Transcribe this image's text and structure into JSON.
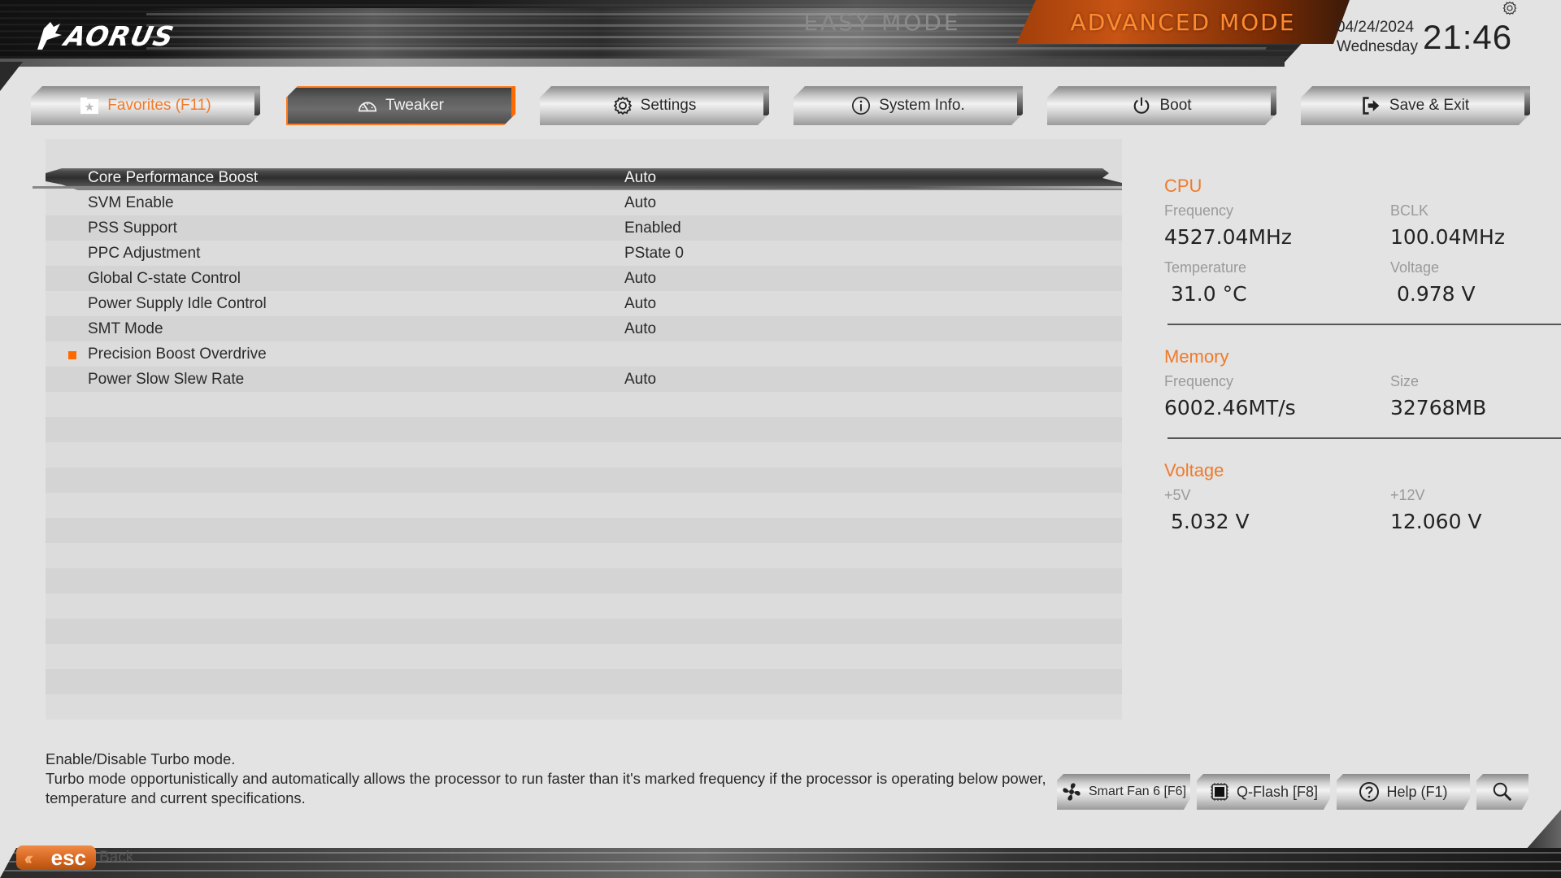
{
  "header": {
    "brand": "AORUS",
    "modes": {
      "easy": "EASY MODE",
      "advanced": "ADVANCED MODE",
      "active": "advanced"
    },
    "date": "04/24/2024",
    "weekday": "Wednesday",
    "time": "21:46"
  },
  "tabs": [
    {
      "label": "Favorites (F11)",
      "icon": "star-folder-icon",
      "active": false,
      "accent": true
    },
    {
      "label": "Tweaker",
      "icon": "speedometer-icon",
      "active": true
    },
    {
      "label": "Settings",
      "icon": "gear-icon",
      "active": false
    },
    {
      "label": "System Info.",
      "icon": "info-circle-icon",
      "active": false
    },
    {
      "label": "Boot",
      "icon": "power-icon",
      "active": false
    },
    {
      "label": "Save & Exit",
      "icon": "exit-icon",
      "active": false
    }
  ],
  "settings": [
    {
      "label": "Core Performance Boost",
      "value": "Auto",
      "selected": true,
      "submenu": false
    },
    {
      "label": "SVM Enable",
      "value": "Auto",
      "selected": false,
      "submenu": false
    },
    {
      "label": "PSS Support",
      "value": "Enabled",
      "selected": false,
      "submenu": false
    },
    {
      "label": "PPC Adjustment",
      "value": "PState 0",
      "selected": false,
      "submenu": false
    },
    {
      "label": "Global C-state Control",
      "value": "Auto",
      "selected": false,
      "submenu": false
    },
    {
      "label": "Power Supply Idle Control",
      "value": "Auto",
      "selected": false,
      "submenu": false
    },
    {
      "label": "SMT Mode",
      "value": "Auto",
      "selected": false,
      "submenu": false
    },
    {
      "label": "Precision Boost Overdrive",
      "value": "",
      "selected": false,
      "submenu": true
    },
    {
      "label": "Power Slow Slew Rate",
      "value": "Auto",
      "selected": false,
      "submenu": false
    }
  ],
  "info": {
    "cpu": {
      "title": "CPU",
      "frequency_label": "Frequency",
      "frequency": "4527.04MHz",
      "bclk_label": "BCLK",
      "bclk": "100.04MHz",
      "temperature_label": "Temperature",
      "temperature": "31.0 °C",
      "voltage_label": "Voltage",
      "voltage": "0.978 V"
    },
    "memory": {
      "title": "Memory",
      "frequency_label": "Frequency",
      "frequency": "6002.46MT/s",
      "size_label": "Size",
      "size": "32768MB"
    },
    "voltage": {
      "title": "Voltage",
      "v5_label": "+5V",
      "v5": "5.032 V",
      "v12_label": "+12V",
      "v12": "12.060 V"
    }
  },
  "help": {
    "line1": "Enable/Disable Turbo mode.",
    "line2": "Turbo mode opportunistically and automatically allows the processor to run faster than it's marked frequency if the processor is operating below power, temperature and current specifications."
  },
  "tools": {
    "smart_fan": "Smart Fan 6 [F6]",
    "qflash": "Q-Flash [F8]",
    "help": "Help (F1)"
  },
  "footer": {
    "esc": "esc",
    "back": "Back"
  },
  "colors": {
    "accent": "#f07a2a",
    "accent_bright": "#ff6a00"
  }
}
